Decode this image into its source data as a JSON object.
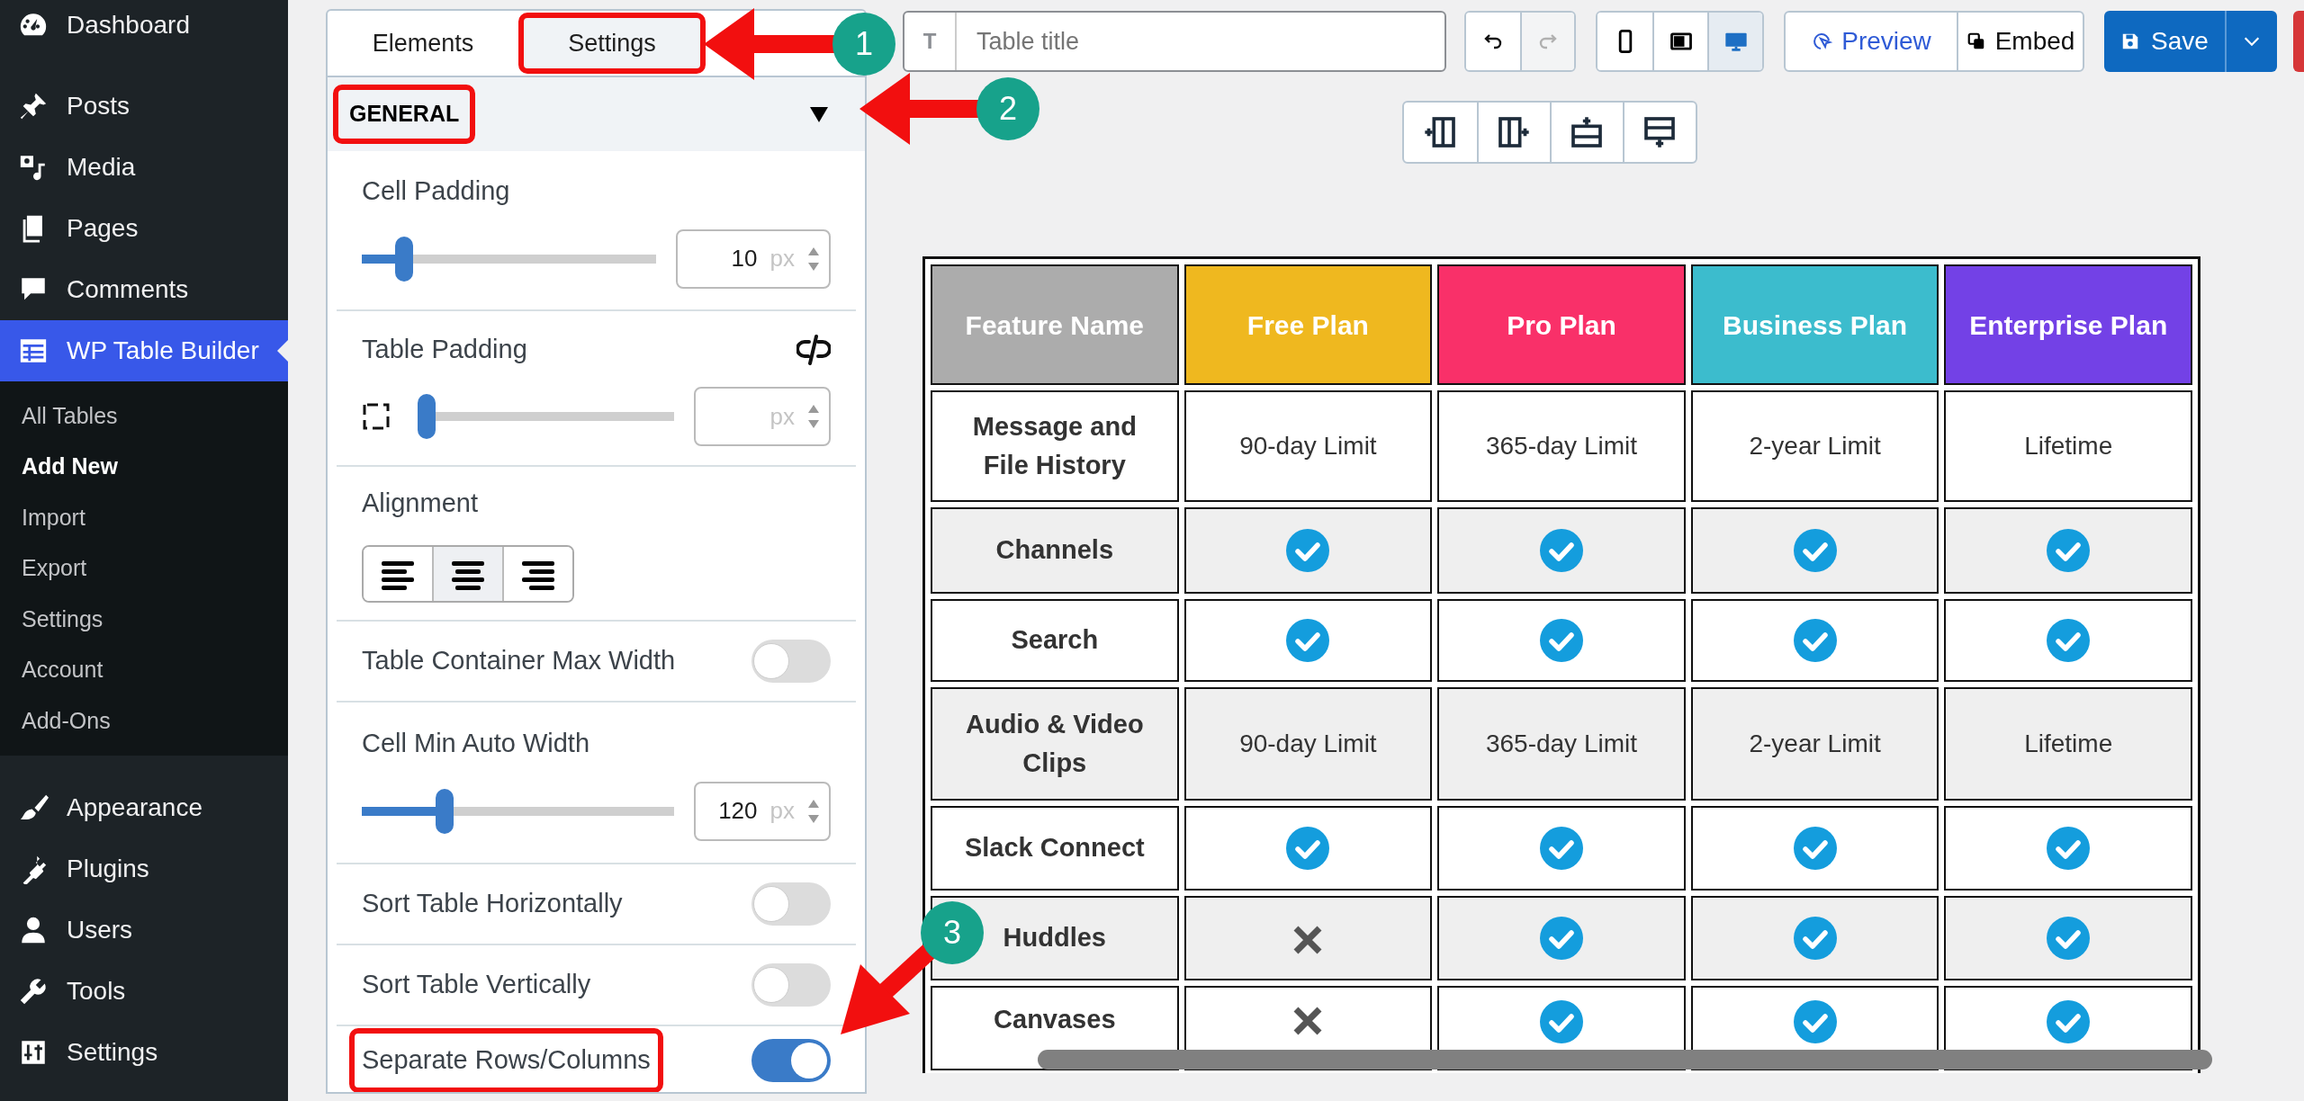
{
  "sidebar": {
    "items": [
      {
        "label": "Dashboard",
        "selected": false
      },
      {
        "label": "Posts",
        "selected": false
      },
      {
        "label": "Media",
        "selected": false
      },
      {
        "label": "Pages",
        "selected": false
      },
      {
        "label": "Comments",
        "selected": false
      },
      {
        "label": "WP Table Builder",
        "selected": true,
        "children": [
          {
            "label": "All Tables",
            "selected": false
          },
          {
            "label": "Add New",
            "selected": true
          },
          {
            "label": "Import",
            "selected": false
          },
          {
            "label": "Export",
            "selected": false
          },
          {
            "label": "Settings",
            "selected": false
          },
          {
            "label": "Account",
            "selected": false
          },
          {
            "label": "Add-Ons",
            "selected": false
          }
        ]
      },
      {
        "label": "Appearance",
        "selected": false
      },
      {
        "label": "Plugins",
        "selected": false
      },
      {
        "label": "Users",
        "selected": false
      },
      {
        "label": "Tools",
        "selected": false
      },
      {
        "label": "Settings",
        "selected": false
      }
    ]
  },
  "settings_panel": {
    "tabs": [
      {
        "label": "Elements",
        "selected": false,
        "highlighted": false
      },
      {
        "label": "Settings",
        "selected": true,
        "highlighted": true
      }
    ],
    "section": {
      "title": "GENERAL",
      "expanded": true,
      "highlighted": true
    },
    "controls": [
      {
        "kind": "slider",
        "label": "Cell Padding",
        "level": 0.12,
        "value": "10",
        "unit": "px"
      },
      {
        "kind": "padding",
        "label": "Table Padding",
        "level": 0.0,
        "unit": "px"
      },
      {
        "kind": "align",
        "label": "Alignment",
        "options": [
          {
            "selected": false
          },
          {
            "selected": true
          },
          {
            "selected": false
          }
        ]
      },
      {
        "kind": "toggle",
        "label": "Table Container Max Width",
        "on": false,
        "highlighted": false
      },
      {
        "kind": "slider",
        "label": "Cell Min Auto Width",
        "level": 0.25,
        "value": "120",
        "unit": "px"
      },
      {
        "kind": "toggle",
        "label": "Sort Table Horizontally",
        "on": false,
        "highlighted": false
      },
      {
        "kind": "toggle",
        "label": "Sort Table Vertically",
        "on": false,
        "highlighted": false
      },
      {
        "kind": "toggle",
        "label": "Separate Rows/Columns",
        "on": true,
        "highlighted": true
      }
    ]
  },
  "toolbar": {
    "title_field": {
      "prefix": "T",
      "placeholder": "Table title"
    },
    "history": [
      {
        "disabled": false
      },
      {
        "disabled": true
      }
    ],
    "devices": [
      {
        "selected": false
      },
      {
        "selected": false
      },
      {
        "selected": true
      }
    ],
    "preview": "Preview",
    "embed": "Embed",
    "save": "Save"
  },
  "table": {
    "columns": [
      {
        "label": "Feature Name",
        "color": "#acacac"
      },
      {
        "label": "Free Plan",
        "color": "#efb81f"
      },
      {
        "label": "Pro Plan",
        "color": "#f93069"
      },
      {
        "label": "Business Plan",
        "color": "#3cbccd"
      },
      {
        "label": "Enterprise Plan",
        "color": "#7341e6"
      }
    ],
    "rows": [
      {
        "cells": [
          {
            "kind": "text",
            "text": "Message and File History"
          },
          {
            "kind": "text",
            "text": "90-day Limit"
          },
          {
            "kind": "text",
            "text": "365-day Limit"
          },
          {
            "kind": "text",
            "text": "2-year Limit"
          },
          {
            "kind": "text",
            "text": "Lifetime"
          }
        ]
      },
      {
        "cells": [
          {
            "kind": "text",
            "text": "Channels"
          },
          {
            "kind": "check"
          },
          {
            "kind": "check"
          },
          {
            "kind": "check"
          },
          {
            "kind": "check"
          }
        ]
      },
      {
        "cells": [
          {
            "kind": "text",
            "text": "Search"
          },
          {
            "kind": "check"
          },
          {
            "kind": "check"
          },
          {
            "kind": "check"
          },
          {
            "kind": "check"
          }
        ]
      },
      {
        "cells": [
          {
            "kind": "text",
            "text": "Audio & Video Clips"
          },
          {
            "kind": "text",
            "text": "90-day Limit"
          },
          {
            "kind": "text",
            "text": "365-day Limit"
          },
          {
            "kind": "text",
            "text": "2-year Limit"
          },
          {
            "kind": "text",
            "text": "Lifetime"
          }
        ]
      },
      {
        "cells": [
          {
            "kind": "text",
            "text": "Slack Connect"
          },
          {
            "kind": "check"
          },
          {
            "kind": "check"
          },
          {
            "kind": "check"
          },
          {
            "kind": "check"
          }
        ]
      },
      {
        "cells": [
          {
            "kind": "text",
            "text": "Huddles"
          },
          {
            "kind": "cross"
          },
          {
            "kind": "check"
          },
          {
            "kind": "check"
          },
          {
            "kind": "check"
          }
        ]
      },
      {
        "cells": [
          {
            "kind": "text",
            "text": "Canvases"
          },
          {
            "kind": "cross"
          },
          {
            "kind": "check"
          },
          {
            "kind": "check"
          },
          {
            "kind": "check"
          }
        ]
      }
    ]
  },
  "annotations": [
    {
      "label": "1"
    },
    {
      "label": "2"
    },
    {
      "label": "3"
    }
  ]
}
